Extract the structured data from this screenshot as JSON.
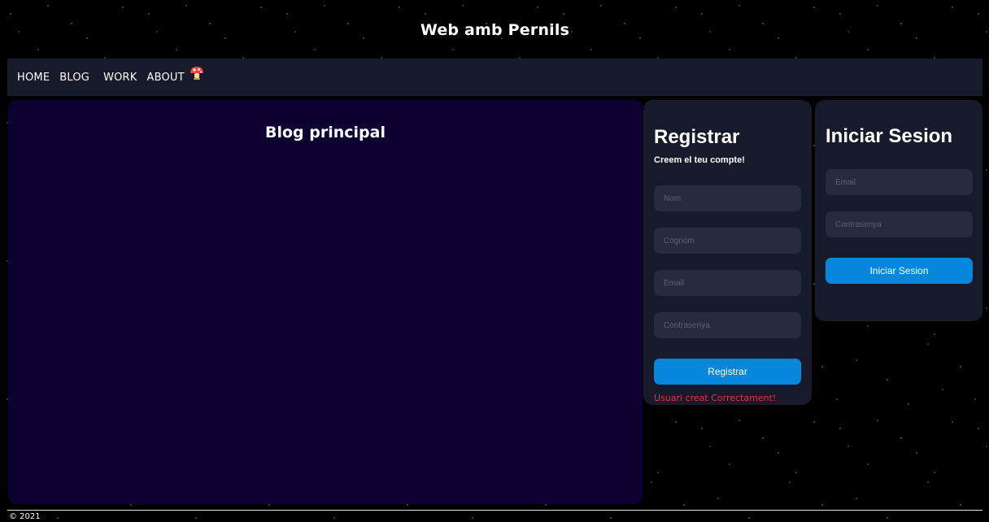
{
  "header": {
    "title": "Web amb Pernils"
  },
  "nav": {
    "home": "HOME",
    "blog": "BLOG",
    "work": "WORK",
    "about": "ABOUT",
    "icon": "mushroom-icon"
  },
  "main": {
    "title": "Blog principal"
  },
  "register": {
    "title": "Registrar",
    "subtitle": "Creem el teu compte!",
    "name_placeholder": "Nom",
    "surname_placeholder": "Cognom",
    "email_placeholder": "Email",
    "password_placeholder": "Contrasenya",
    "button_label": "Registrar",
    "status": "Usuari creat Correctament!"
  },
  "login": {
    "title": "Iniciar Sesion",
    "email_placeholder": "Email",
    "password_placeholder": "Contrasenya",
    "button_label": "Iniciar Sesion"
  },
  "footer": {
    "copyright": "© 2021"
  },
  "colors": {
    "panel": "#161a2b",
    "blog_bg": "#0e0131",
    "input_bg": "#262b3d",
    "button": "#0787dc",
    "error_text": "#e8323c"
  }
}
